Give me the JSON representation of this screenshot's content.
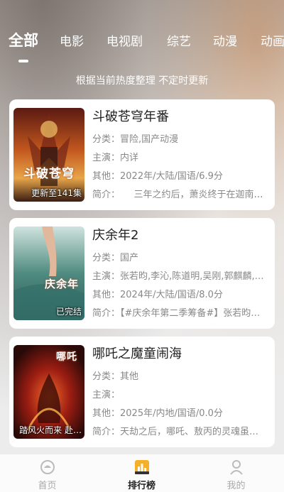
{
  "tabs": [
    "全部",
    "电影",
    "电视剧",
    "综艺",
    "动漫",
    "动画"
  ],
  "active_tab": "全部",
  "subtitle": "根据当前热度整理 不定时更新",
  "labels": {
    "category": "分类：",
    "cast": "主演：",
    "other": "其他：",
    "intro": "简介："
  },
  "items": [
    {
      "title": "斗破苍穹年番",
      "category": "冒险,国产动漫",
      "cast": "内详",
      "other": "2022年/大陆/国语/6.9分",
      "intro": "　　三年之约后，萧炎终于在迦南学院见到了…",
      "badge": "更新至141集",
      "poster_text": "斗破苍穹"
    },
    {
      "title": "庆余年2",
      "category": "国产",
      "cast": "张若昀,李沁,陈道明,吴刚,郭麒麟,…",
      "other": "2024年/大陆/国语/8.0分",
      "intro": "【#庆余年第二季筹备#】张若昀…",
      "badge": "已完结",
      "poster_text": "庆余年"
    },
    {
      "title": "哪吒之魔童闹海",
      "category": "其他",
      "cast": "",
      "other": "2025年/内地/国语/0.0分",
      "intro": "天劫之后，哪吒、敖丙的灵魂虽…",
      "badge": "踏风火而来 赴…",
      "poster_text": "哪吒"
    }
  ],
  "nav": [
    {
      "label": "首页",
      "icon": "home-icon"
    },
    {
      "label": "排行榜",
      "icon": "chart-icon"
    },
    {
      "label": "我的",
      "icon": "user-icon"
    }
  ],
  "active_nav": "排行榜"
}
